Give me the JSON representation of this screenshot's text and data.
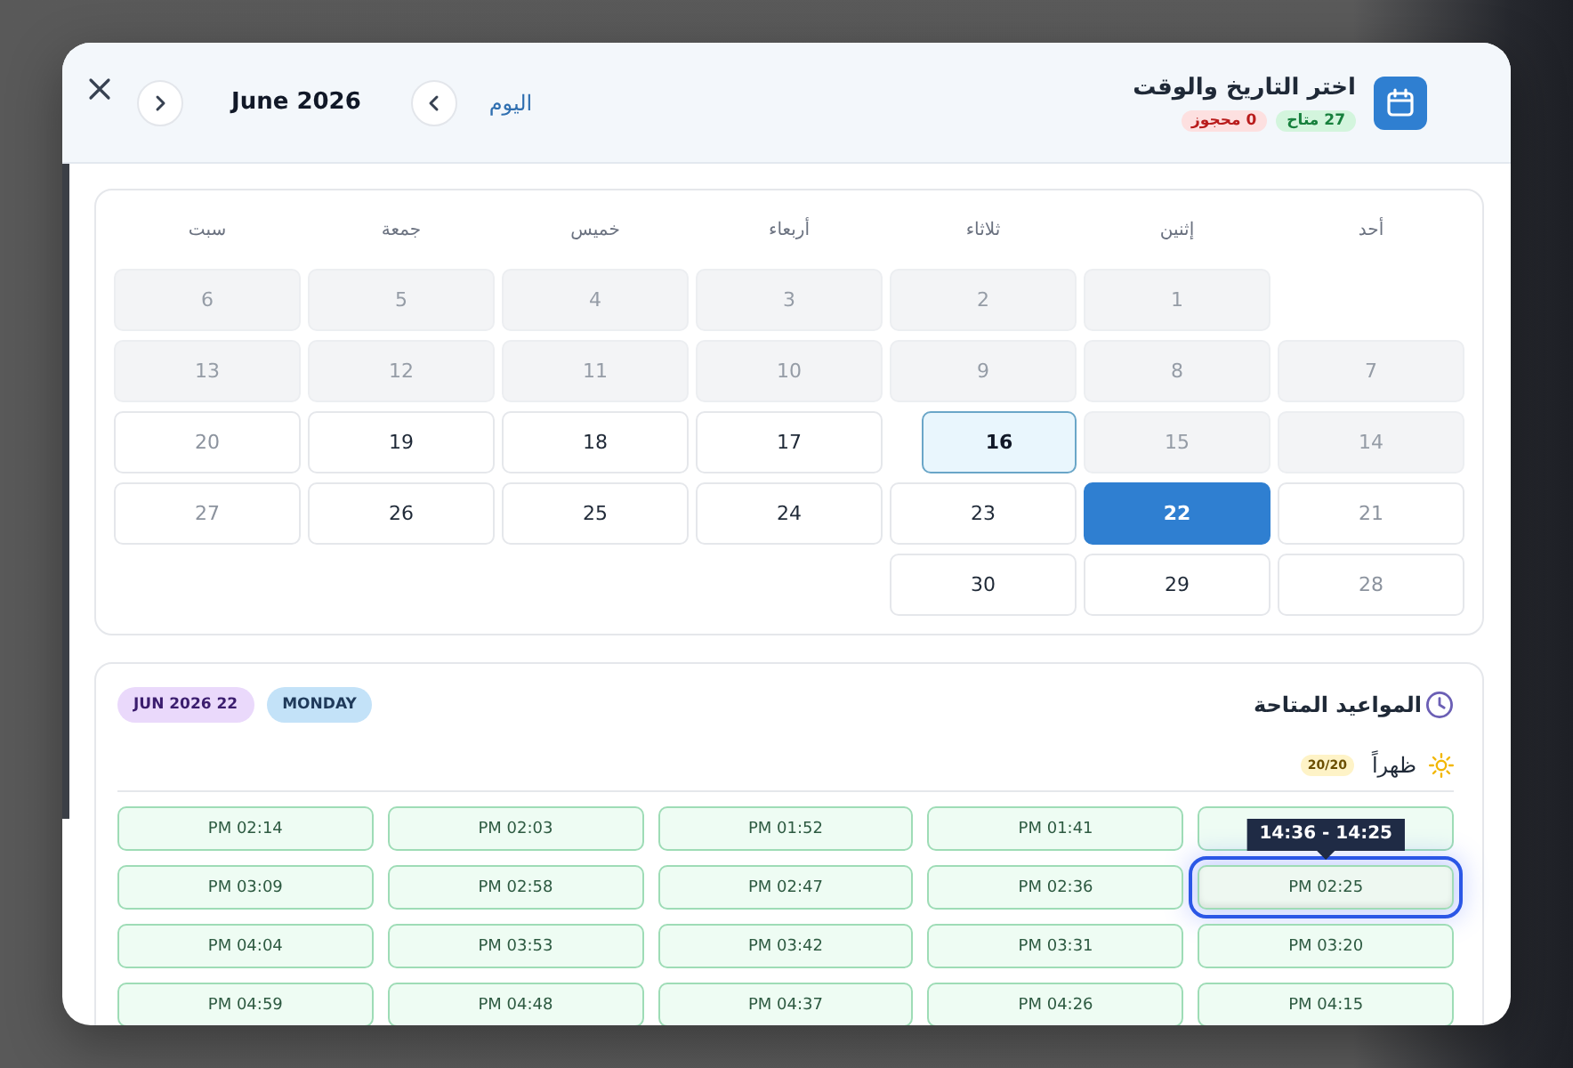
{
  "header": {
    "title": "اختر التاريخ والوقت",
    "badges": [
      {
        "kind": "available",
        "text": "27 متاح"
      },
      {
        "kind": "booked",
        "text": "0 محجوز"
      }
    ],
    "today_link": "اليوم",
    "month": "June 2026"
  },
  "calendar": {
    "weekdays": [
      "أحد",
      "إثنين",
      "ثلاثاء",
      "أربعاء",
      "خميس",
      "جمعة",
      "سبت"
    ],
    "weeks": [
      [
        {
          "kind": "blank"
        },
        {
          "day": "1",
          "kind": "past",
          "today": false,
          "selected": false
        },
        {
          "day": "2",
          "kind": "past",
          "today": false,
          "selected": false
        },
        {
          "day": "3",
          "kind": "past",
          "today": false,
          "selected": false
        },
        {
          "day": "4",
          "kind": "past",
          "today": false,
          "selected": false
        },
        {
          "day": "5",
          "kind": "past",
          "today": false,
          "selected": false
        },
        {
          "day": "6",
          "kind": "past",
          "today": false,
          "selected": false
        }
      ],
      [
        {
          "day": "7",
          "kind": "past",
          "today": false,
          "selected": false
        },
        {
          "day": "8",
          "kind": "past",
          "today": false,
          "selected": false
        },
        {
          "day": "9",
          "kind": "past",
          "today": false,
          "selected": false
        },
        {
          "day": "10",
          "kind": "past",
          "today": false,
          "selected": false
        },
        {
          "day": "11",
          "kind": "past",
          "today": false,
          "selected": false
        },
        {
          "day": "12",
          "kind": "past",
          "today": false,
          "selected": false
        },
        {
          "day": "13",
          "kind": "past",
          "today": false,
          "selected": false
        }
      ],
      [
        {
          "day": "14",
          "kind": "past",
          "today": false,
          "selected": false
        },
        {
          "day": "15",
          "kind": "past",
          "today": false,
          "selected": false
        },
        {
          "day": "16",
          "kind": "open",
          "today": true,
          "selected": false
        },
        {
          "day": "17",
          "kind": "open",
          "today": false,
          "selected": false
        },
        {
          "day": "18",
          "kind": "open",
          "today": false,
          "selected": false
        },
        {
          "day": "19",
          "kind": "open",
          "today": false,
          "selected": false
        },
        {
          "day": "20",
          "kind": "weekend",
          "today": false,
          "selected": false
        }
      ],
      [
        {
          "day": "21",
          "kind": "weekend",
          "today": false,
          "selected": false
        },
        {
          "day": "22",
          "kind": "open",
          "today": false,
          "selected": true
        },
        {
          "day": "23",
          "kind": "open",
          "today": false,
          "selected": false
        },
        {
          "day": "24",
          "kind": "open",
          "today": false,
          "selected": false
        },
        {
          "day": "25",
          "kind": "open",
          "today": false,
          "selected": false
        },
        {
          "day": "26",
          "kind": "open",
          "today": false,
          "selected": false
        },
        {
          "day": "27",
          "kind": "weekend",
          "today": false,
          "selected": false
        }
      ],
      [
        {
          "day": "28",
          "kind": "weekend",
          "today": false,
          "selected": false
        },
        {
          "day": "29",
          "kind": "open",
          "today": false,
          "selected": false
        },
        {
          "day": "30",
          "kind": "open",
          "today": false,
          "selected": false
        }
      ]
    ]
  },
  "slots": {
    "title": "المواعيد المتاحة",
    "tags": [
      {
        "kind": "weekday",
        "text": "MONDAY"
      },
      {
        "kind": "date",
        "text": "JUN 2026 22"
      }
    ],
    "period": {
      "label": "ظهراً",
      "count": "20/20"
    },
    "rows": [
      [
        {
          "hovered": false
        },
        {
          "time": "PM 01:41",
          "hovered": false
        },
        {
          "time": "PM 01:52",
          "hovered": false
        },
        {
          "time": "PM 02:03",
          "hovered": false
        },
        {
          "time": "PM 02:14",
          "hovered": false
        }
      ],
      [
        {
          "time": "PM 02:25",
          "hovered": true,
          "tooltip": "14:36 - 14:25"
        },
        {
          "time": "PM 02:36",
          "hovered": false
        },
        {
          "time": "PM 02:47",
          "hovered": false
        },
        {
          "time": "PM 02:58",
          "hovered": false
        },
        {
          "time": "PM 03:09",
          "hovered": false
        }
      ],
      [
        {
          "time": "PM 03:20",
          "hovered": false
        },
        {
          "time": "PM 03:31",
          "hovered": false
        },
        {
          "time": "PM 03:42",
          "hovered": false
        },
        {
          "time": "PM 03:53",
          "hovered": false
        },
        {
          "time": "PM 04:04",
          "hovered": false
        }
      ],
      [
        {
          "time": "PM 04:15",
          "hovered": false
        },
        {
          "time": "PM 04:26",
          "hovered": false
        },
        {
          "time": "PM 04:37",
          "hovered": false
        },
        {
          "time": "PM 04:48",
          "hovered": false
        },
        {
          "time": "PM 04:59",
          "hovered": false
        }
      ]
    ]
  }
}
